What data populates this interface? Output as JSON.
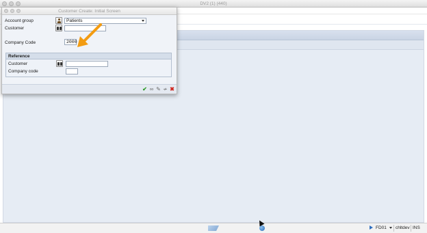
{
  "main_window": {
    "title": "DV2 (1) (440)"
  },
  "dialog": {
    "title": "Customer Create: Initial Screen",
    "account_group": {
      "label": "Account group",
      "value": "Patients"
    },
    "customer": {
      "label": "Customer",
      "value": ""
    },
    "company_code": {
      "label": "Company Code",
      "value": "2000"
    },
    "reference": {
      "title": "Reference",
      "customer_label": "Customer",
      "customer_value": "",
      "company_code_label": "Company code",
      "company_code_value": ""
    },
    "footer_buttons": [
      {
        "name": "continue",
        "icon": "check-icon",
        "glyph": "✔"
      },
      {
        "name": "display",
        "icon": "glasses-icon",
        "glyph": "∞"
      },
      {
        "name": "edit",
        "icon": "pencil-icon",
        "glyph": "✎"
      },
      {
        "name": "other",
        "icon": "other-icon",
        "glyph": "≁"
      },
      {
        "name": "cancel",
        "icon": "close-icon",
        "glyph": "✖"
      }
    ]
  },
  "status_bar": {
    "system": "FD01",
    "server": "chltdev",
    "mode": "INS"
  },
  "colors": {
    "annotation_arrow": "#f39c12",
    "accept": "#2d9a28",
    "cancel": "#d0271f"
  }
}
